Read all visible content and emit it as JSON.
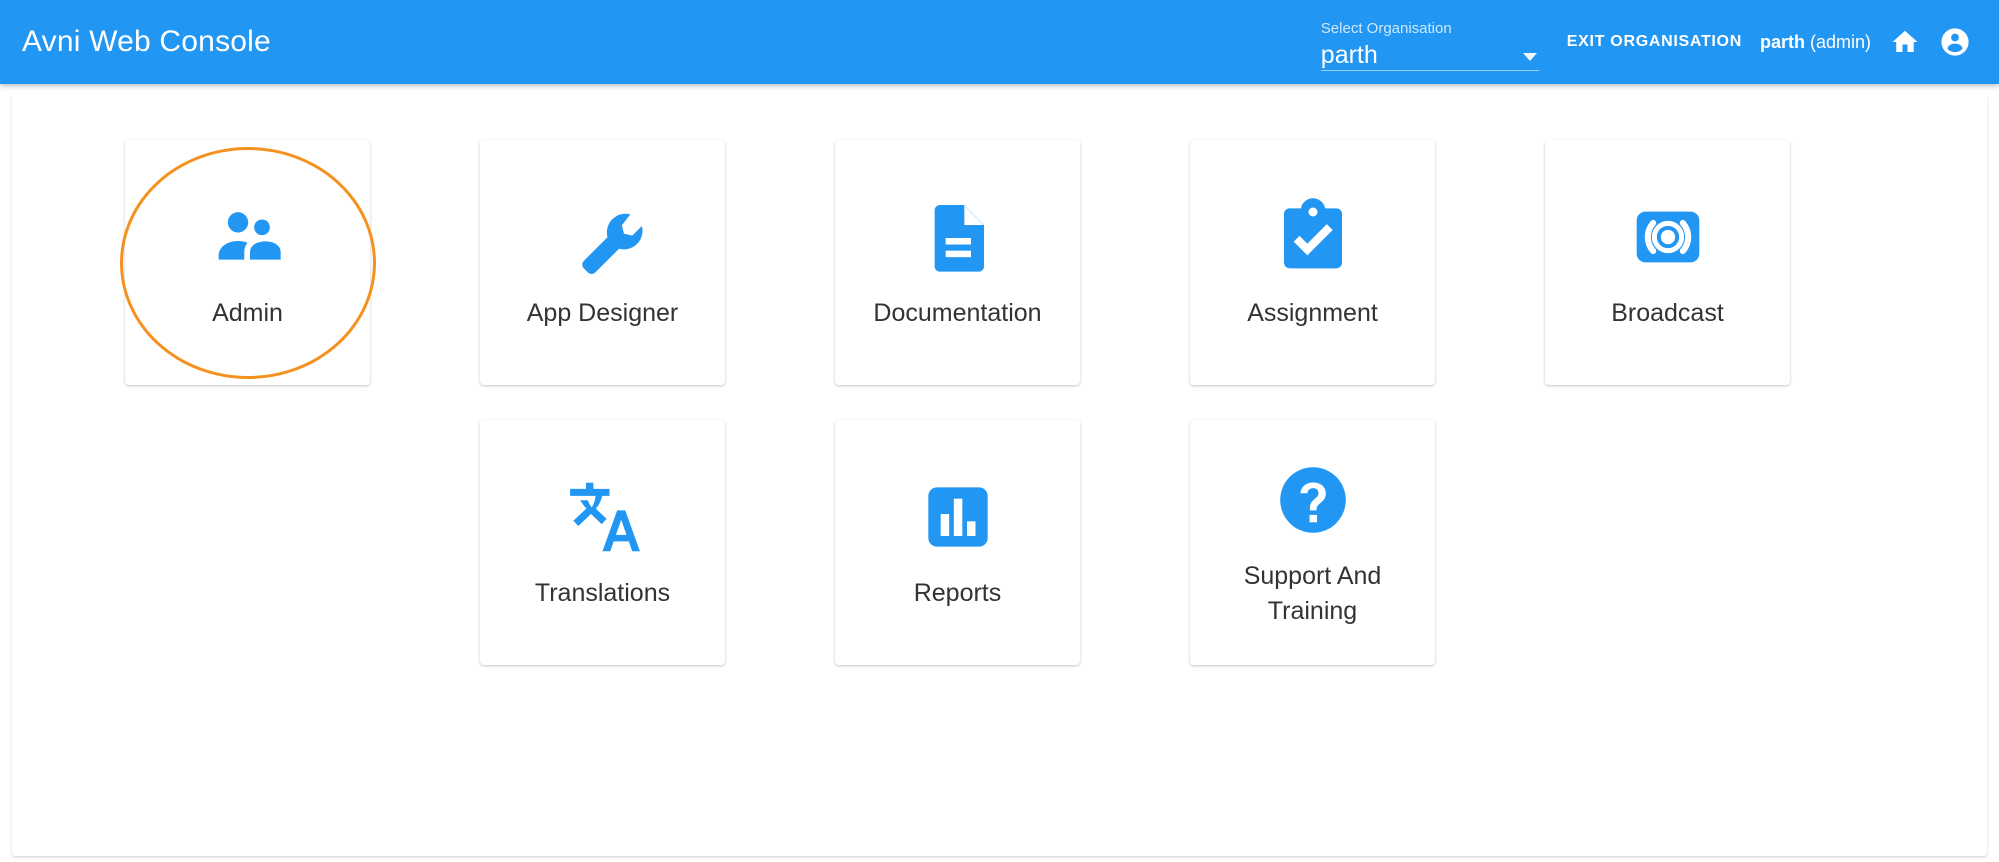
{
  "appbar": {
    "title": "Avni Web Console",
    "org_select": {
      "label": "Select Organisation",
      "value": "parth",
      "arrow_icon": "chevron-down-icon"
    },
    "exit_organisation_label": "EXIT ORGANISATION",
    "user_name": "parth",
    "user_role": "(admin)",
    "home_icon": "home-icon",
    "account_icon": "account-circle-icon",
    "background_color": "#2196f3",
    "text_color": "#ffffff"
  },
  "highlight": {
    "color": "#f5911e",
    "target": "Admin"
  },
  "tiles": [
    {
      "label": "Admin",
      "icon": "people-icon",
      "highlighted": true
    },
    {
      "label": "App Designer",
      "icon": "wrench-icon",
      "highlighted": false
    },
    {
      "label": "Documentation",
      "icon": "document-icon",
      "highlighted": false
    },
    {
      "label": "Assignment",
      "icon": "clipboard-check-icon",
      "highlighted": false
    },
    {
      "label": "Broadcast",
      "icon": "broadcast-icon",
      "highlighted": false
    },
    {
      "label": "Translations",
      "icon": "translate-icon",
      "highlighted": false
    },
    {
      "label": "Reports",
      "icon": "bar-chart-icon",
      "highlighted": false
    },
    {
      "label": "Support And Training",
      "icon": "help-circle-icon",
      "highlighted": false
    }
  ],
  "colors": {
    "accent": "#2196f3",
    "icon_blue": "#2196f3",
    "highlight_orange": "#f5911e",
    "page_background": "#ffffff",
    "label_text": "#333333"
  }
}
